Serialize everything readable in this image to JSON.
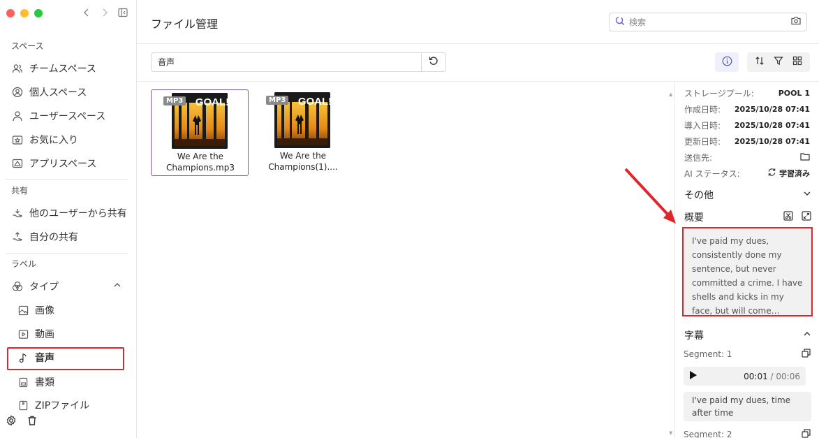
{
  "window": {
    "title": "ファイル管理"
  },
  "sidebar": {
    "sections": {
      "space": "スペース",
      "shared": "共有",
      "label": "ラベル"
    },
    "space_items": [
      {
        "label": "チームスペース",
        "icon": "team-icon"
      },
      {
        "label": "個人スペース",
        "icon": "person-circle-icon"
      },
      {
        "label": "ユーザースペース",
        "icon": "user-icon"
      },
      {
        "label": "お気に入り",
        "icon": "favorite-icon"
      },
      {
        "label": "アプリスペース",
        "icon": "app-icon"
      }
    ],
    "shared_items": [
      {
        "label": "他のユーザーから共有",
        "icon": "share-in-icon"
      },
      {
        "label": "自分の共有",
        "icon": "share-out-icon"
      }
    ],
    "type_group": {
      "label": "タイプ",
      "expanded": true
    },
    "type_items": [
      {
        "label": "画像",
        "icon": "image-icon"
      },
      {
        "label": "動画",
        "icon": "video-icon"
      },
      {
        "label": "音声",
        "icon": "music-icon",
        "selected": true
      },
      {
        "label": "書類",
        "icon": "document-icon"
      },
      {
        "label": "ZIPファイル",
        "icon": "zip-icon"
      }
    ]
  },
  "header": {
    "search_placeholder": "検索"
  },
  "toolbar": {
    "filter_value": "音声"
  },
  "files": [
    {
      "badge": "MP3",
      "name_line1": "We Are the",
      "name_line2": "Champions.mp3",
      "selected": true,
      "cover_title": "GOAL!"
    },
    {
      "badge": "MP3",
      "name_line1": "We Are the",
      "name_line2": "Champions(1)....",
      "selected": false,
      "cover_title": "GOAL!"
    }
  ],
  "details": {
    "meta": [
      {
        "label": "ストレージプール:",
        "value": "POOL 1"
      },
      {
        "label": "作成日時:",
        "value": "2025/10/28 07:41"
      },
      {
        "label": "導入日時:",
        "value": "2025/10/28 07:41"
      },
      {
        "label": "更新日時:",
        "value": "2025/10/28 07:41"
      },
      {
        "label": "送信先:",
        "value": ""
      },
      {
        "label": "AI ステータス:",
        "value": "学習済み"
      }
    ],
    "other_label": "その他",
    "summary_label": "概要",
    "summary_text": "I've paid my dues, consistently done my sentence, but never committed a crime. I have shells and kicks in my face, but will come through. We...",
    "subtitle_label": "字幕",
    "segments": [
      {
        "label": "Segment: 1",
        "time_current": "00:01",
        "time_total": "/ 00:06",
        "text": "I've paid my dues, time after time"
      },
      {
        "label": "Segment: 2"
      }
    ]
  },
  "colors": {
    "accent": "#6b5bd2",
    "highlight": "#e0262b"
  }
}
